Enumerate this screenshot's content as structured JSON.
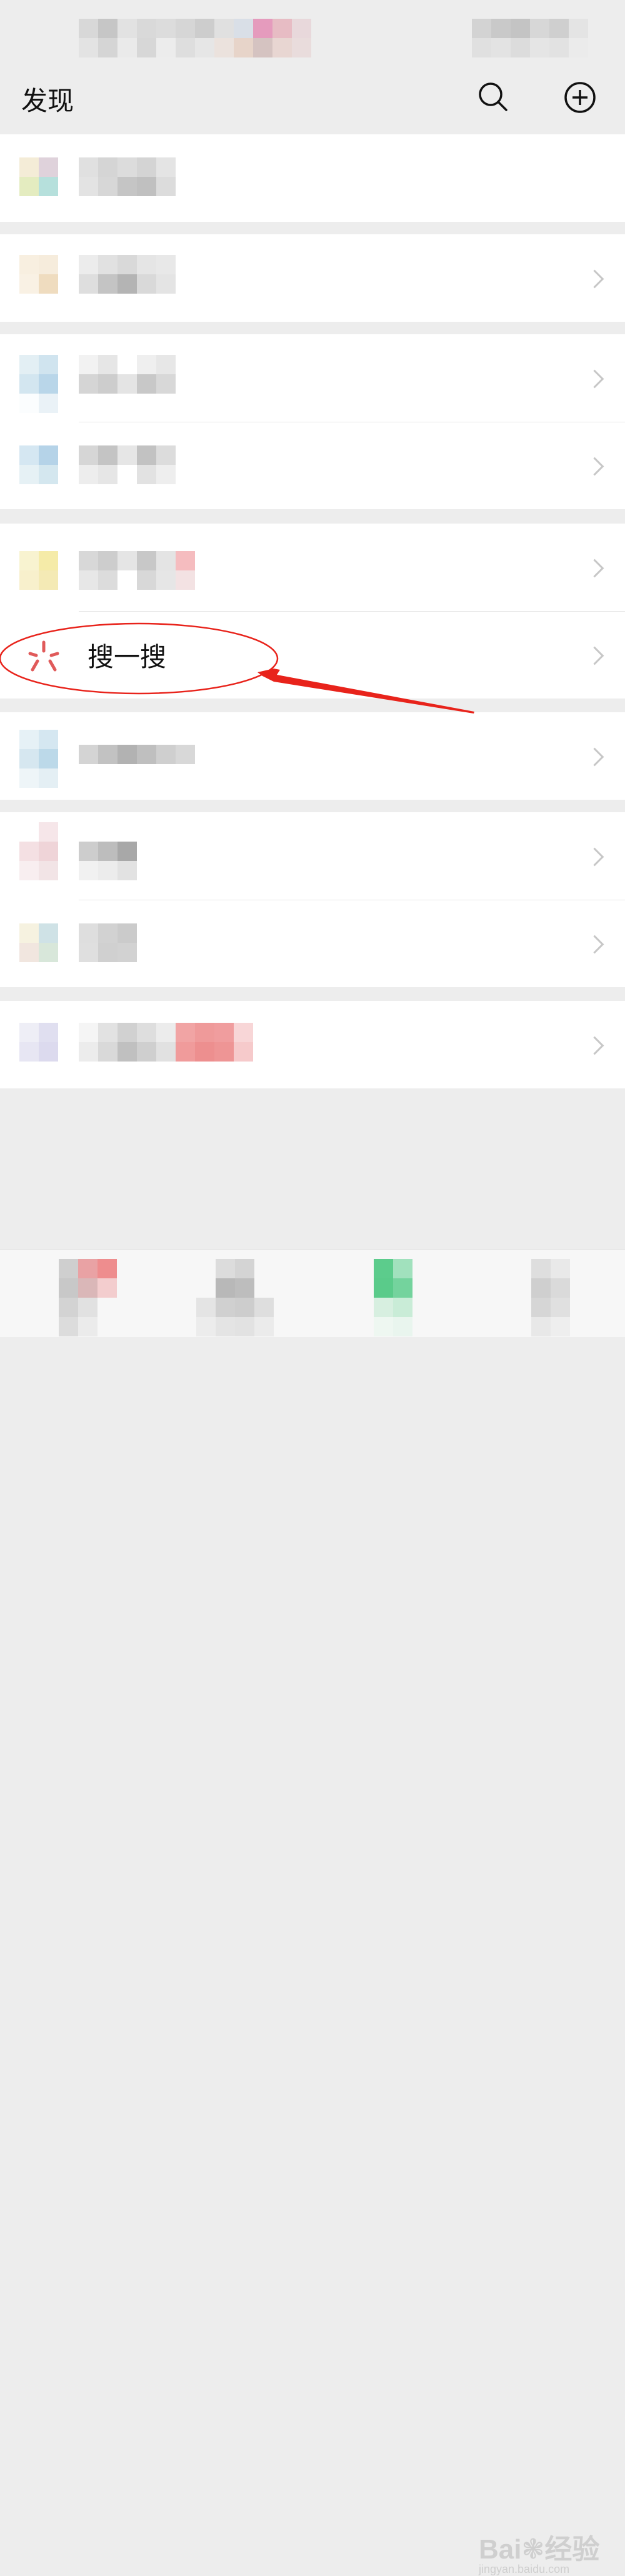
{
  "header": {
    "title": "发现",
    "search_icon": "search-icon",
    "add_icon": "plus-circle-icon"
  },
  "search_item": {
    "label": "搜一搜",
    "icon": "search-sparkle-icon"
  },
  "colors": {
    "background": "#ededed",
    "annotation": "#e8231b",
    "chevron": "#c7c7c7"
  },
  "watermark": {
    "brand": "Bai",
    "brand_suffix": "经验",
    "url": "jingyan.baidu.com"
  }
}
